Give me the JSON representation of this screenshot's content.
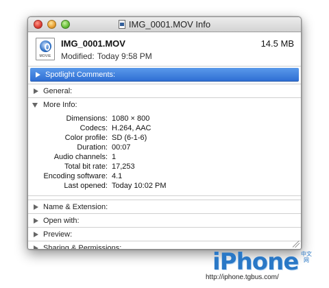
{
  "window": {
    "title": "IMG_0001.MOV Info"
  },
  "file": {
    "icon": "movie-file-icon",
    "icon_label": "MOVIE",
    "name": "IMG_0001.MOV",
    "size": "14.5 MB",
    "modified_label": "Modified:",
    "modified_value": "Today 9:58 PM"
  },
  "sections": {
    "spotlight": "Spotlight Comments:",
    "general": "General:",
    "more_info": "More Info:",
    "name_ext": "Name & Extension:",
    "open_with": "Open with:",
    "preview": "Preview:",
    "sharing": "Sharing & Permissions:"
  },
  "more_info": [
    {
      "key": "Dimensions:",
      "value": "1080 × 800"
    },
    {
      "key": "Codecs:",
      "value": "H.264, AAC"
    },
    {
      "key": "Color profile:",
      "value": "SD (6-1-6)"
    },
    {
      "key": "Duration:",
      "value": "00:07"
    },
    {
      "key": "Audio channels:",
      "value": "1"
    },
    {
      "key": "Total bit rate:",
      "value": "17,253"
    },
    {
      "key": "Encoding software:",
      "value": "4.1"
    },
    {
      "key": "Last opened:",
      "value": "Today 10:02 PM"
    }
  ],
  "watermark": {
    "logo": "iPhone",
    "cn": "中文网",
    "url": "http://iphone.tgbus.com/"
  },
  "colors": {
    "selection": "#2f6fd4",
    "watermark": "#2a78c6"
  }
}
